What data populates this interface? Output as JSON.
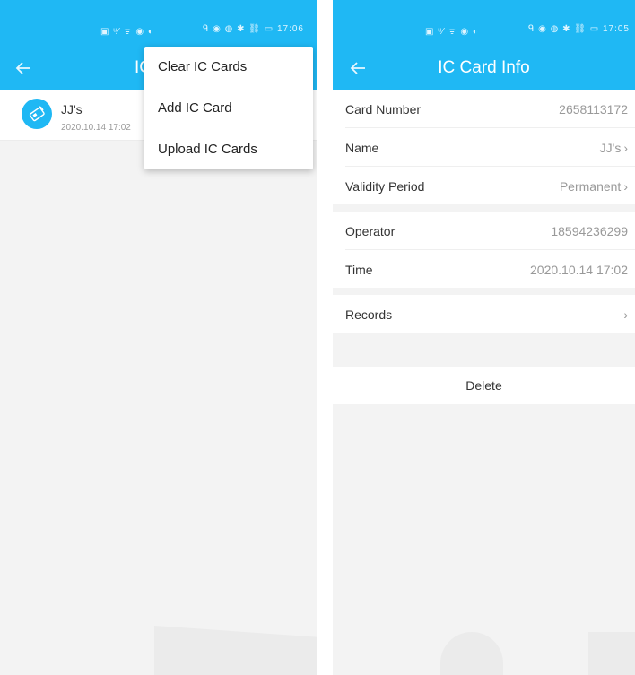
{
  "left": {
    "status": {
      "left_icons": "▣ ᵘ⁄ ᯤ ◉ ◐",
      "right_icons": "ᑫ ◉ ◍ ✱ ⛓ ▭",
      "time": "17:06"
    },
    "title_partial": "IC",
    "list": [
      {
        "name": "JJ's",
        "time": "2020.10.14 17:02"
      }
    ],
    "menu": [
      "Clear IC Cards",
      "Add IC Card",
      "Upload IC Cards"
    ]
  },
  "right": {
    "status": {
      "left_icons": "▣ ᵘ⁄ ᯤ ◉ ◐",
      "right_icons": "ᑫ ◉ ◍ ✱ ⛓ ▭",
      "time": "17:05"
    },
    "title": "IC Card Info",
    "rows1": [
      {
        "label": "Card Number",
        "value": "2658113172",
        "arrow": false
      },
      {
        "label": "Name",
        "value": "JJ's",
        "arrow": true
      },
      {
        "label": "Validity Period",
        "value": "Permanent",
        "arrow": true
      }
    ],
    "rows2": [
      {
        "label": "Operator",
        "value": "18594236299",
        "arrow": false
      },
      {
        "label": "Time",
        "value": "2020.10.14 17:02",
        "arrow": false
      }
    ],
    "records": {
      "label": "Records"
    },
    "delete": "Delete"
  },
  "icons": {
    "back": "arrow-left-icon",
    "chevron": "chevron-right-icon",
    "card": "ic-card-icon"
  },
  "colors": {
    "primary": "#1fb8f4",
    "background": "#f3f3f3"
  }
}
